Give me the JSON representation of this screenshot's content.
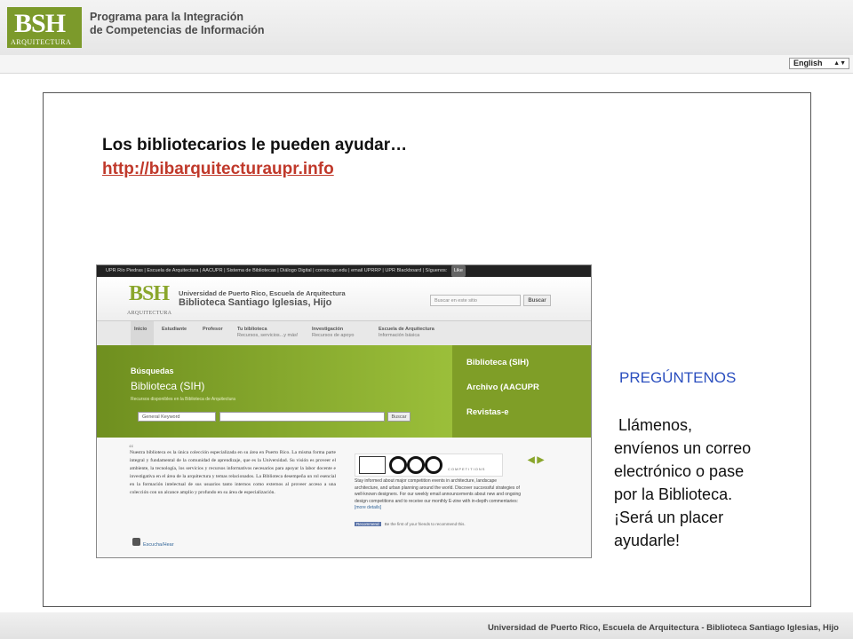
{
  "header": {
    "logo_mark": "BSH",
    "logo_sub": "ARQUITECTURA",
    "program_line1": "Programa para la Integración",
    "program_line2": "de Competencias de Información",
    "language": "English"
  },
  "slide": {
    "heading": "Los bibliotecarios le pueden ayudar…",
    "url": "http://bibarquitecturaupr.info",
    "ask_label": "PREGÚNTENOS",
    "call_lines": [
      " Llámenos,",
      "envíenos un correo",
      "electrónico o pase",
      "por la Biblioteca.",
      "¡Será un placer",
      "ayudarle!"
    ]
  },
  "embedded_site": {
    "topbar": "UPR Río Piedras | Escuela de Arquitectura | AACUPR | Sistema de Bibliotecas | Diálogo Digital | correo.upr.edu | email UPRRP | UPR Blackboard |",
    "follow_label": "Síguenos:",
    "follow_btn": "Like",
    "logo_mark": "BSH",
    "logo_sub": "ARQUITECTURA",
    "university": "Universidad de Puerto Rico, Escuela de Arquitectura",
    "library": "Biblioteca Santiago Iglesias, Hijo",
    "search_placeholder": "Buscar en este sitio",
    "search_btn": "Buscar",
    "nav": [
      {
        "label": "Inicio",
        "sub": ""
      },
      {
        "label": "Estudiante",
        "sub": ""
      },
      {
        "label": "Profesor",
        "sub": ""
      },
      {
        "label": "Tu biblioteca",
        "sub": "Recursos, servicios...y más!"
      },
      {
        "label": "Investigación",
        "sub": "Recursos de apoyo"
      },
      {
        "label": "Escuela de Arquitectura",
        "sub": "Información básica"
      }
    ],
    "busquedas": "Búsquedas",
    "biblioteca_sih": "Biblioteca (SIH)",
    "recursos_note": "Recursos disponibles en la Biblioteca de Arquitectura",
    "keyword": "General Keyword",
    "buscar": "Buscar",
    "panel_links": [
      "Biblioteca (SIH)",
      "Archivo (AACUPR",
      "Revistas-e"
    ],
    "intro_text": "Nuestra biblioteca es la única colección especializada en su área en Puerto Rico. La misma forma parte integral y fundamental de la comunidad de aprendizaje, que es la Universidad. Su visión es proveer el ambiente, la tecnología, los servicios y recursos informativos necesarios para apoyar la labor docente e investigativa en el área de la arquitectura y temas relacionados. La Biblioteca desempeña un rol esencial en la formación intelectual de sus usuarios tanto internos como externos al proveer acceso a una colección con un alcance amplio y profundo en su área de especialización.",
    "listen": "Escucha/Hear",
    "competitions": "COMPETITIONS",
    "comp_text": "Stay informed about major competition events in architecture, landscape architecture, and urban planning around the world. Discover successful strategies of well-known designers. For our weekly email announcements about new and ongoing design competitions and to receive our monthly E-zine with in-depth commentaries:",
    "more_details": "[more details]",
    "recommend_btn": "Recommend",
    "recommend_text": "Be the first of your friends to recommend this.",
    "arrows": "◀ ▶"
  },
  "footer": {
    "text": "Universidad de Puerto Rico, Escuela de Arquitectura - Biblioteca Santiago Iglesias, Hijo"
  }
}
